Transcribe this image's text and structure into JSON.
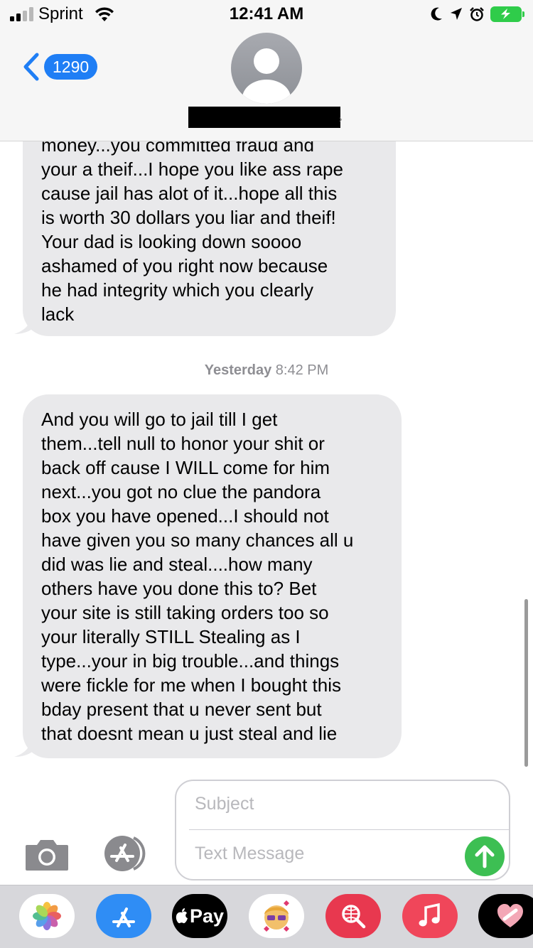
{
  "status_bar": {
    "carrier": "Sprint",
    "time": "12:41 AM",
    "signal_bars_filled": 2,
    "signal_bars_total": 4,
    "battery_state": "charging"
  },
  "header": {
    "back_count": "1290",
    "contact_name_redacted": true
  },
  "messages": [
    {
      "direction": "incoming",
      "text": "money...you committed fraud and\nyour a theif...I hope you like ass rape\ncause jail has alot of it...hope all this\nis worth 30 dollars you liar and theif!\nYour dad is looking down soooo\nashamed of you right  now because\nhe had integrity which you clearly\nlack"
    },
    {
      "direction": "incoming",
      "text": "And you will go to jail till I get\nthem...tell null to honor your shit or\nback off cause I WILL come for him\nnext...you got no clue the pandora\nbox you have opened...I should not\nhave given you so many chances all u\ndid was lie and steal....how many\nothers have you done this to? Bet\nyour site is still taking orders too so\nyour literally STILL Stealing as I\ntype...your in big trouble...and things\nwere fickle for me when I bought this\nbday present that u never sent but\nthat doesnt mean u just steal and lie"
    }
  ],
  "timestamp": {
    "day": "Yesterday",
    "time": "8:42 PM"
  },
  "compose": {
    "subject_placeholder": "Subject",
    "message_placeholder": "Text Message"
  },
  "app_drawer": {
    "apple_pay_label": "Pay",
    "apps": [
      "photos-app-icon",
      "app-store-icon",
      "apple-pay-icon",
      "memoji-icon",
      "web-search-icon",
      "music-icon",
      "digital-touch-icon"
    ]
  },
  "colors": {
    "accent_blue": "#1f7ef5",
    "bubble_gray": "#e9e9eb",
    "send_green": "#3dbf53",
    "battery_green": "#2fcc4a"
  }
}
